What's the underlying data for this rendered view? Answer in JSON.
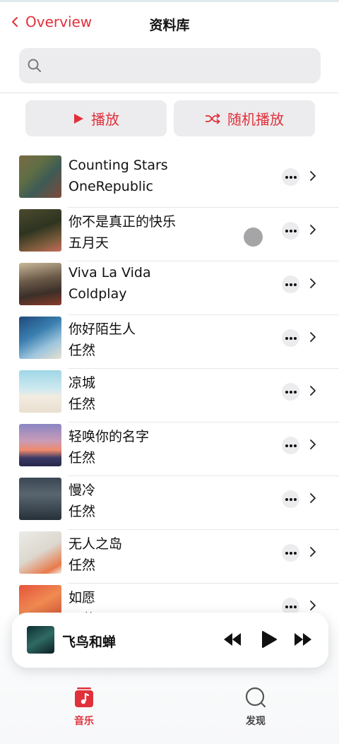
{
  "header": {
    "back_label": "Overview",
    "title": "资料库"
  },
  "search": {
    "placeholder": ""
  },
  "actions": {
    "play_label": "播放",
    "shuffle_label": "随机播放"
  },
  "songs": [
    {
      "title": "Counting Stars",
      "artist": "OneRepublic"
    },
    {
      "title": "你不是真正的快乐",
      "artist": "五月天"
    },
    {
      "title": "Viva La Vida",
      "artist": "Coldplay"
    },
    {
      "title": "你好陌生人",
      "artist": "任然"
    },
    {
      "title": "凉城",
      "artist": "任然"
    },
    {
      "title": "轻唤你的名字",
      "artist": "任然"
    },
    {
      "title": "慢冷",
      "artist": "任然"
    },
    {
      "title": "无人之岛",
      "artist": "任然"
    },
    {
      "title": "如愿",
      "artist": "王菲"
    }
  ],
  "now_playing": {
    "title": "飞鸟和蝉"
  },
  "tabs": [
    {
      "label": "音乐",
      "active": true
    },
    {
      "label": "发现",
      "active": false
    }
  ],
  "colors": {
    "accent": "#e0313b",
    "surface": "#ececee"
  }
}
